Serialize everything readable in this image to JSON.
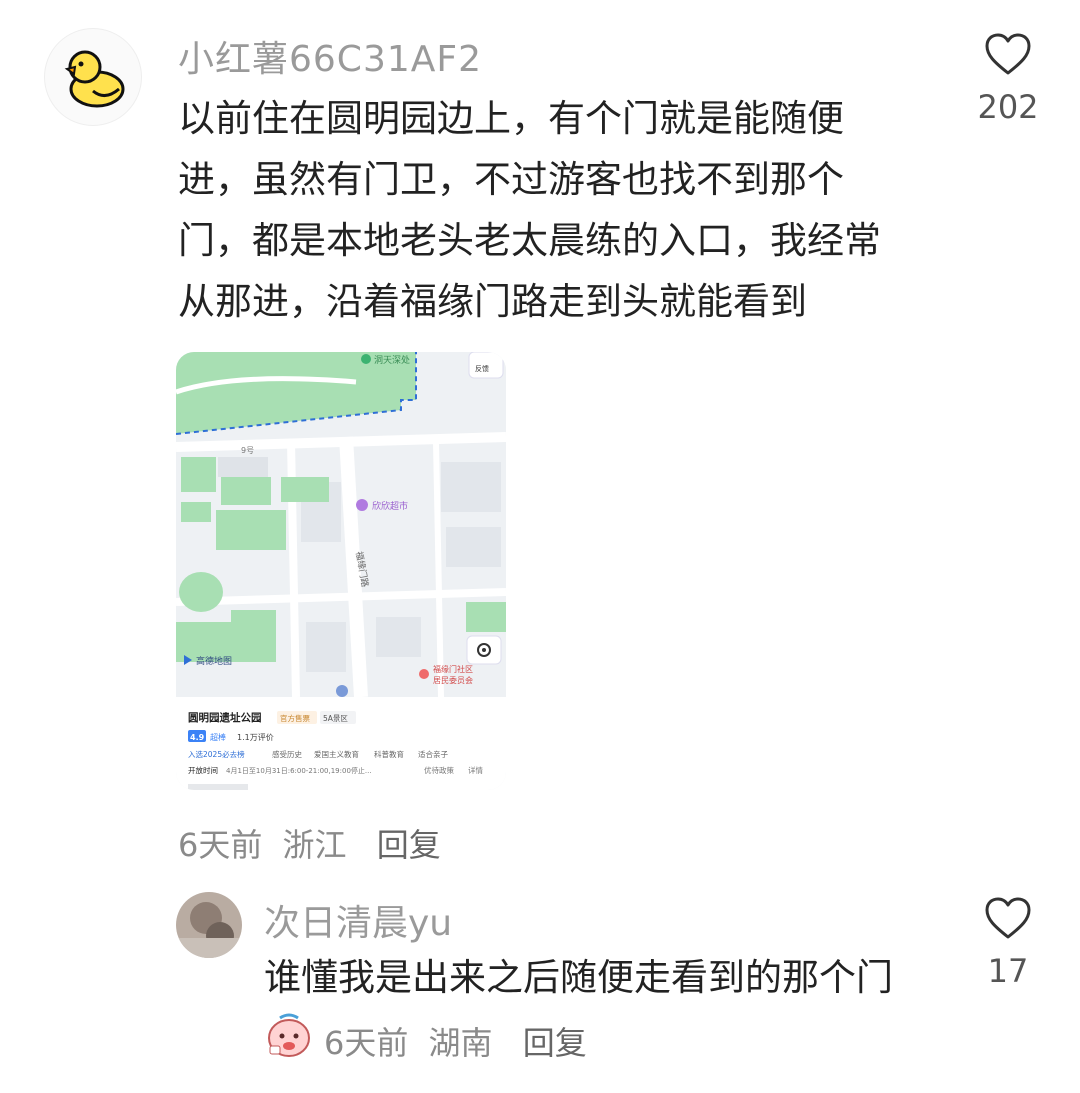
{
  "comment": {
    "username": "小红薯66C31AF2",
    "avatar_icon": "duck-icon",
    "text_lines": [
      "以前住在圆明园边上，有个门就是能随便",
      "进，虽然有门卫，不过游客也找不到那个",
      "门，都是本地老头老太晨练的入口，我经常",
      "从那进，沿着福缘门路走到头就能看到"
    ],
    "likes": "202",
    "time": "6天前",
    "location": "浙江",
    "reply_label": "回复"
  },
  "map_card": {
    "top_labels": {
      "park": "洞天深处",
      "feedback": "反馈",
      "block": "9号"
    },
    "poi_market": "欣欣超市",
    "road_name": "福缘门路",
    "brand": "高德地图",
    "committee_line1": "福缘门社区",
    "committee_line2": "居民委员会",
    "place_name": "圆明园遗址公园",
    "tag_official": "官方售票",
    "tag_level": "5A景区",
    "rating": "4.9",
    "rating_word": "超棒",
    "reviews": "1.1万评价",
    "rank": "入选2025必去榜",
    "tags": [
      "感受历史",
      "爱国主义教育",
      "科普教育",
      "适合亲子"
    ],
    "hours_label": "开放时间",
    "hours": "4月1日至10月31日:6:00-21:00,19:00停止...",
    "policy": "优待政策",
    "detail": "详情"
  },
  "reply": {
    "username": "次日清晨yu",
    "text": "谁懂我是出来之后随便走看到的那个门",
    "likes": "17",
    "time": "6天前",
    "location": "湖南",
    "reply_label": "回复"
  },
  "colors": {
    "username": "#9a9a9a",
    "meta": "#8a8a8a",
    "map_green": "#a8dfb3",
    "map_blue_dash": "#2f6fd6",
    "rating_blue": "#3b82f6"
  }
}
